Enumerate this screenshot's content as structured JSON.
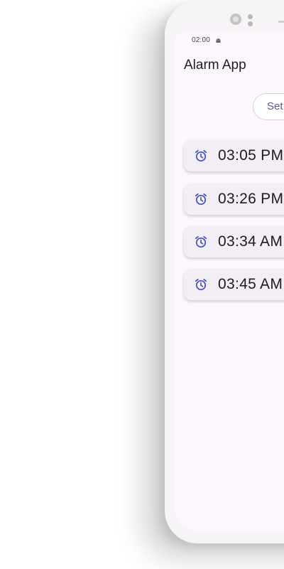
{
  "status_bar": {
    "time": "02:00",
    "status_icon": "android-debug-icon"
  },
  "app_bar": {
    "title": "Alarm App"
  },
  "set_button": {
    "label": "Set"
  },
  "alarms": [
    {
      "time": "03:05 PM",
      "icon": "alarm-clock-icon"
    },
    {
      "time": "03:26 PM",
      "icon": "alarm-clock-icon"
    },
    {
      "time": "03:34 AM",
      "icon": "alarm-clock-icon"
    },
    {
      "time": "03:45 AM",
      "icon": "alarm-clock-icon"
    }
  ],
  "colors": {
    "screen_bg": "#fdf7fd",
    "card_bg": "#f3edf5",
    "accent": "#3f51b5",
    "button_text": "#5a5a8c"
  }
}
